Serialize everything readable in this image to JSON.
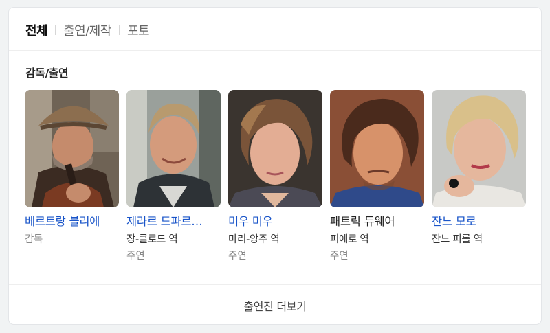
{
  "tabs": [
    {
      "label": "전체",
      "active": true
    },
    {
      "label": "출연/제작",
      "active": false
    },
    {
      "label": "포토",
      "active": false
    }
  ],
  "section": {
    "title": "감독/출연"
  },
  "people": [
    {
      "name": "베르트랑 블리에",
      "role": "감독",
      "sub": "",
      "linked": true
    },
    {
      "name": "제라르 드파르…",
      "role": "장-클로드 역",
      "sub": "주연",
      "linked": true
    },
    {
      "name": "미우 미우",
      "role": "마리-앙주 역",
      "sub": "주연",
      "linked": true
    },
    {
      "name": "패트릭 듀웨어",
      "role": "피에로 역",
      "sub": "주연",
      "linked": false
    },
    {
      "name": "잔느 모로",
      "role": "잔느 피롤 역",
      "sub": "",
      "linked": true
    }
  ],
  "more": {
    "label": "출연진 더보기"
  },
  "colors": {
    "link": "#1a55c9",
    "text": "#222222",
    "muted": "#888888",
    "background": "#f1f3f4",
    "card": "#ffffff"
  }
}
